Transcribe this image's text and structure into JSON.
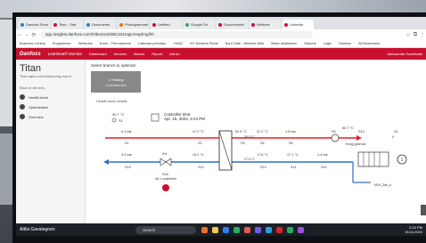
{
  "browser": {
    "tabs": [
      {
        "label": "Danfoss Store",
        "color": "#2b7bd6"
      },
      {
        "label": "Titan - Star",
        "color": "#c8102e"
      },
      {
        "label": "Documents",
        "color": "#2b7bd6"
      },
      {
        "label": "Photogrammet",
        "color": "#e07b00"
      },
      {
        "label": "Untitled",
        "color": "#c8102e"
      },
      {
        "label": "Google Dri",
        "color": "#3aa757"
      },
      {
        "label": "Documentati",
        "color": "#c8102e"
      },
      {
        "label": "Webinar",
        "color": "#c8102e"
      },
      {
        "label": "LinkedIn",
        "color": "#c8102e"
      }
    ],
    "url": "app.insights.danfoss.com/#/devices/SBC151/app-leapfrog/hh",
    "bookmarks": [
      "Business Central",
      "Programmer",
      "Webinars",
      "Excel - Prenotazione",
      "Calendar prenotaz.",
      "HVAC",
      "NY Network Portal",
      "Nord Gate - Network Web",
      "Meter distribution",
      "Reporte",
      "Login",
      "Danfoss",
      "All Bookmarks"
    ]
  },
  "app": {
    "logo": "Danfoss",
    "title": "Leanheat® Monitor",
    "menu": [
      "Dashboard",
      "Devices",
      "Alarms",
      "Report",
      "Admin"
    ],
    "user": "Aleksandar Gavelinski",
    "sidebar": {
      "title": "Titan",
      "subtitle": "Titan aqua commissioning report",
      "breadcrumb": "Back to devices",
      "nav": [
        "Heatfit block",
        "Optimization",
        "Overview"
      ]
    },
    "main": {
      "select_label": "Select branch to optimize",
      "selected_card": {
        "title": "1 Heating",
        "subtitle": "Commissioned"
      },
      "link": "Heatfit block details"
    }
  },
  "diagram": {
    "controller": {
      "label": "Controller time:",
      "time": "Apr. 15, 2024, 2:24 PM"
    },
    "sensors_top": [
      {
        "id": "S1",
        "value": "4.1 bar"
      },
      {
        "id": "S2",
        "value": "47.2 °C"
      },
      {
        "id": "S3",
        "value": "52.5 °C"
      },
      {
        "id": "S4",
        "value": "37.2 °C"
      },
      {
        "id": "S5",
        "value": "1.5 bar"
      },
      {
        "id": "S13",
        "value": "60.7 °C"
      }
    ],
    "sensors_bottom": [
      {
        "id": "S15",
        "value": "4.4 bar"
      },
      {
        "id": "S14",
        "value": "14.2 °C"
      },
      {
        "id": "S12",
        "value": "17.6 °C"
      },
      {
        "id": "S11",
        "value": "17.1 °C"
      },
      {
        "id": "S10",
        "value": "1.4 bar"
      }
    ],
    "temps_extra": [
      "30.0 °C",
      "27.9 °C"
    ],
    "outdoor": {
      "value": "30.7 °C",
      "id": "S1"
    },
    "supply_label": "Krug gramat",
    "pump_label": "S9",
    "valve_label": "S16",
    "valve_value": "46.1 undefined",
    "valve_percent": "0%",
    "circle_label": "1",
    "return_label": "M19_Zah_b",
    "right_values": [
      "0",
      "33"
    ]
  },
  "taskbar": {
    "user": "Attila Gavalegovic",
    "search": "Search",
    "time": "2:24 PM",
    "date": "15.04.2024",
    "lang": "ENG"
  },
  "colors": {
    "brand": "#c8102e",
    "supply": "#e0202a",
    "return": "#2f6fbf"
  }
}
